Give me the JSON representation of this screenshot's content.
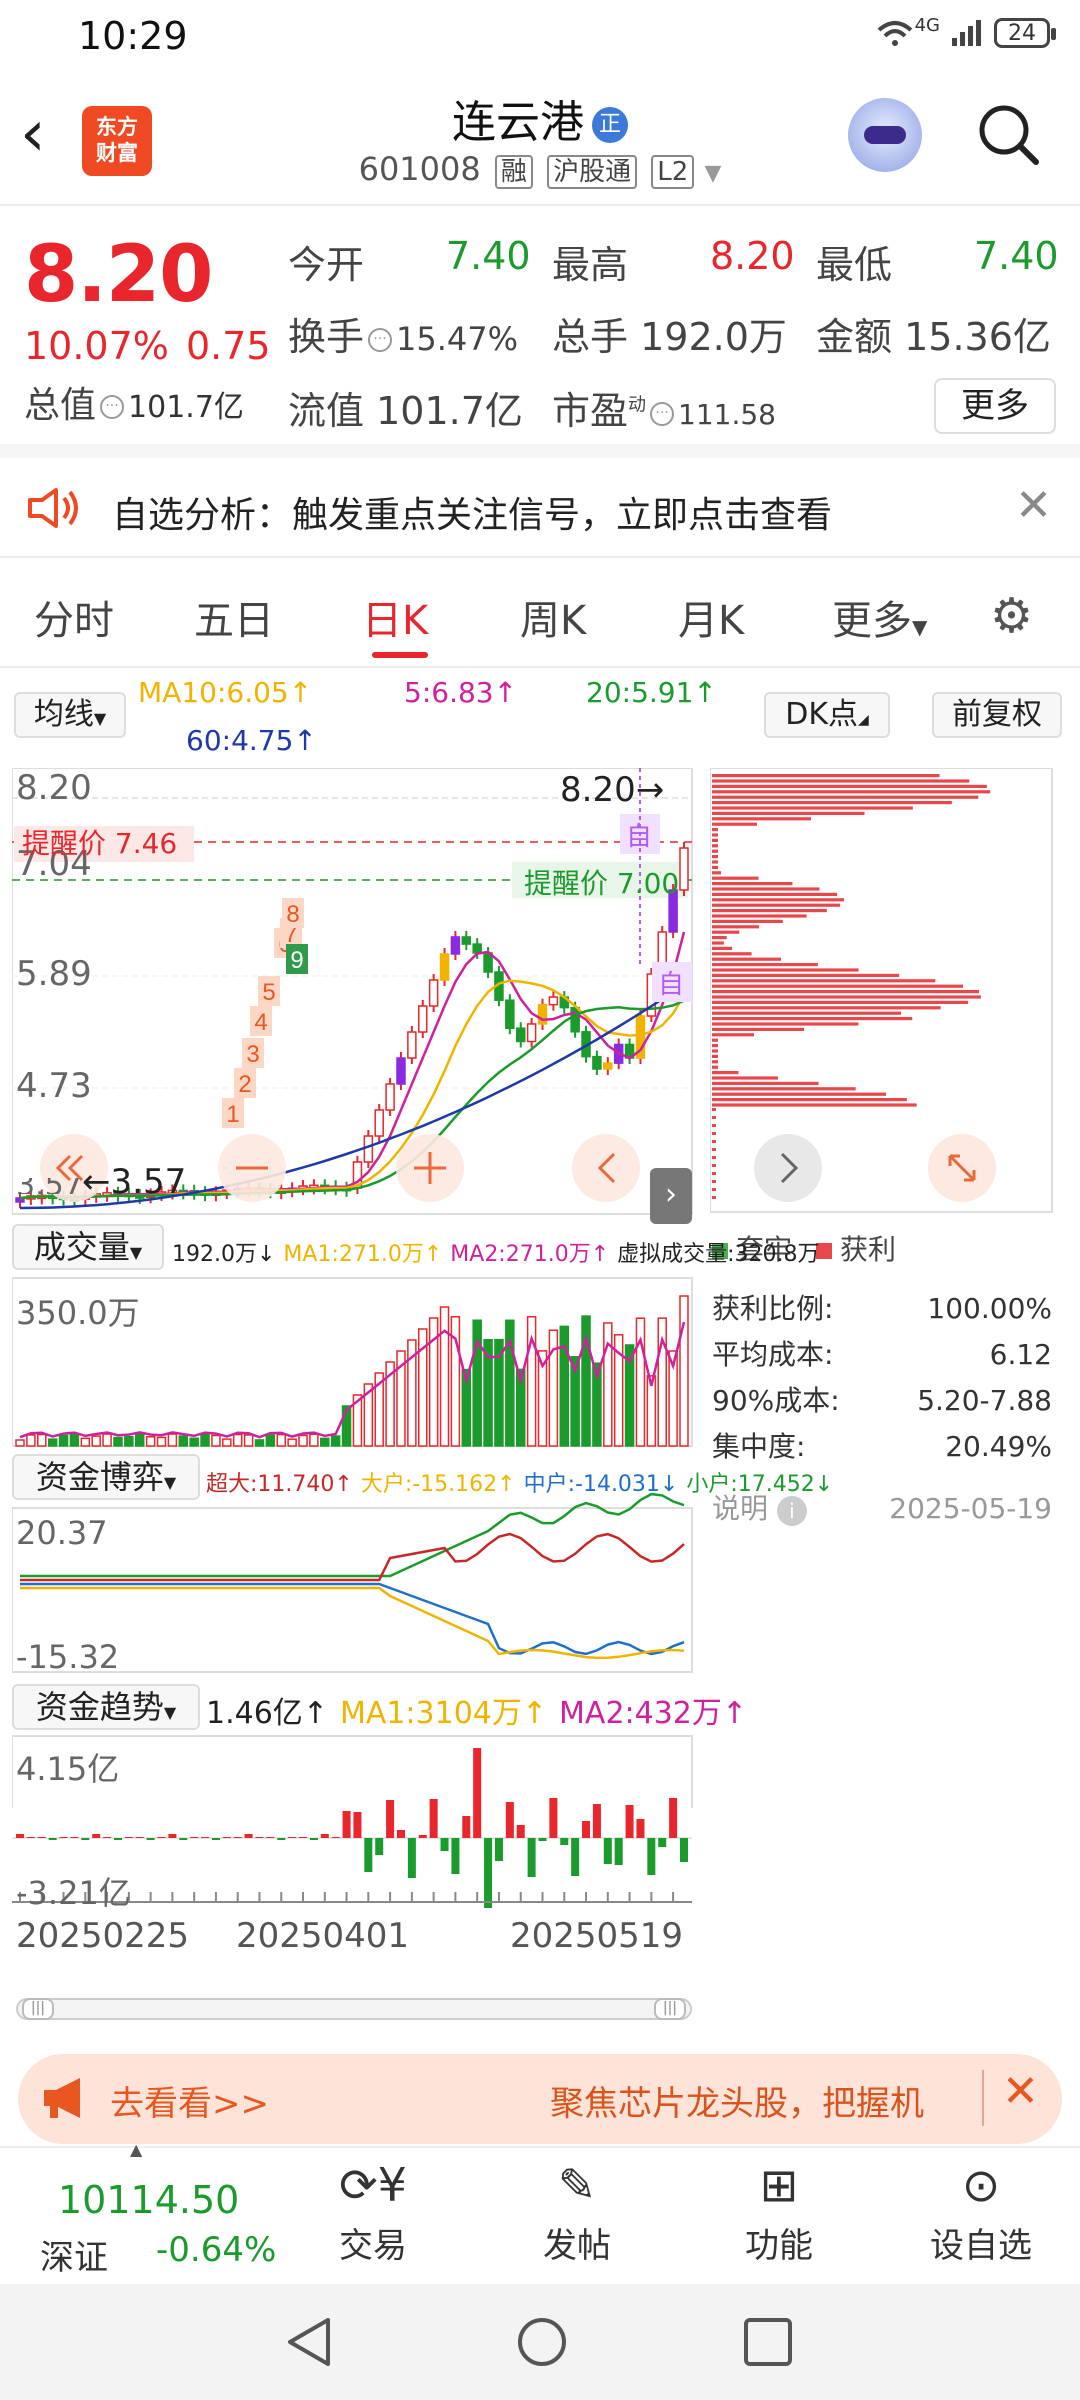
{
  "status": {
    "time": "10:29",
    "network": "4G",
    "battery": "24"
  },
  "header": {
    "name": "连云港",
    "badge": "正",
    "code": "601008",
    "tags": [
      "融",
      "沪股通",
      "L2"
    ],
    "logo_line1": "东方",
    "logo_line2": "财富"
  },
  "quote": {
    "price": "8.20",
    "change_pct": "10.07%",
    "change": "0.75",
    "open_label": "今开",
    "open": "7.40",
    "high_label": "最高",
    "high": "8.20",
    "low_label": "最低",
    "low": "7.40",
    "turnover_label": "换手",
    "turnover": "15.47%",
    "volume_label": "总手",
    "volume": "192.0万",
    "amount_label": "金额",
    "amount": "15.36亿",
    "mcap_label": "总值",
    "mcap": "101.7亿",
    "float_label": "流值",
    "float": "101.7亿",
    "pe_label": "市盈",
    "pe_sup": "动",
    "pe": "111.58",
    "more": "更多"
  },
  "notice": {
    "text": "自选分析：触发重点关注信号，立即点击查看"
  },
  "tabs": [
    "分时",
    "五日",
    "日K",
    "周K",
    "月K",
    "更多"
  ],
  "active_tab": "日K",
  "kline": {
    "ma_selector": "均线",
    "ma10": "MA10:6.05↑",
    "ma5": "5:6.83↑",
    "ma20": "20:5.91↑",
    "ma60": "60:4.75↑",
    "dk_button": "DK点",
    "adjust_button": "前复权",
    "y_labels": [
      "8.20",
      "7.04",
      "5.89",
      "4.73",
      "3.57"
    ],
    "last_price_label": "8.20",
    "low_label": "3.57",
    "alert_high": "提醒价 7.46",
    "alert_mid": "提醒价 7.00",
    "self_tag": "自",
    "markers": [
      "1",
      "2",
      "3",
      "4",
      "5",
      "6",
      "7",
      "8",
      "9"
    ]
  },
  "volume": {
    "selector": "成交量",
    "info": "192.0万↓",
    "ma1": "MA1:271.0万↑",
    "ma2": "MA2:271.0万↑",
    "virtual": "虚拟成交量:320.8万",
    "y_label": "350.0万"
  },
  "capital_game": {
    "selector": "资金博弈",
    "super": "超大:11.740↑",
    "large": "大户:-15.162↑",
    "mid": "中户:-14.031↓",
    "small": "小户:17.452↓",
    "y_top": "20.37",
    "y_bottom": "-15.32"
  },
  "capital_trend": {
    "selector": "资金趋势",
    "value": "1.46亿↑",
    "ma1": "MA1:3104万↑",
    "ma2": "MA2:432万↑",
    "y_top": "4.15亿",
    "y_bottom": "-3.21亿"
  },
  "x_dates": [
    "20250225",
    "20250401",
    "20250519"
  ],
  "chips": {
    "legend_trapped": "套牢",
    "legend_profit": "获利",
    "profit_ratio_label": "获利比例:",
    "profit_ratio": "100.00%",
    "avg_cost_label": "平均成本:",
    "avg_cost": "6.12",
    "cost90_label": "90%成本:",
    "cost90": "5.20-7.88",
    "concentration_label": "集中度:",
    "concentration": "20.49%",
    "note_label": "说明",
    "date": "2025-05-19"
  },
  "banner": {
    "left": "去看看>>",
    "right": "聚焦芯片龙头股，把握机"
  },
  "bottom_bar": {
    "index_value": "10114.50",
    "index_name": "深证",
    "index_change": "-0.64%",
    "items": [
      "交易",
      "发帖",
      "功能",
      "设自选"
    ]
  },
  "colors": {
    "up": "#e8262b",
    "down": "#1a9b2c",
    "accent": "#f04a24"
  }
}
